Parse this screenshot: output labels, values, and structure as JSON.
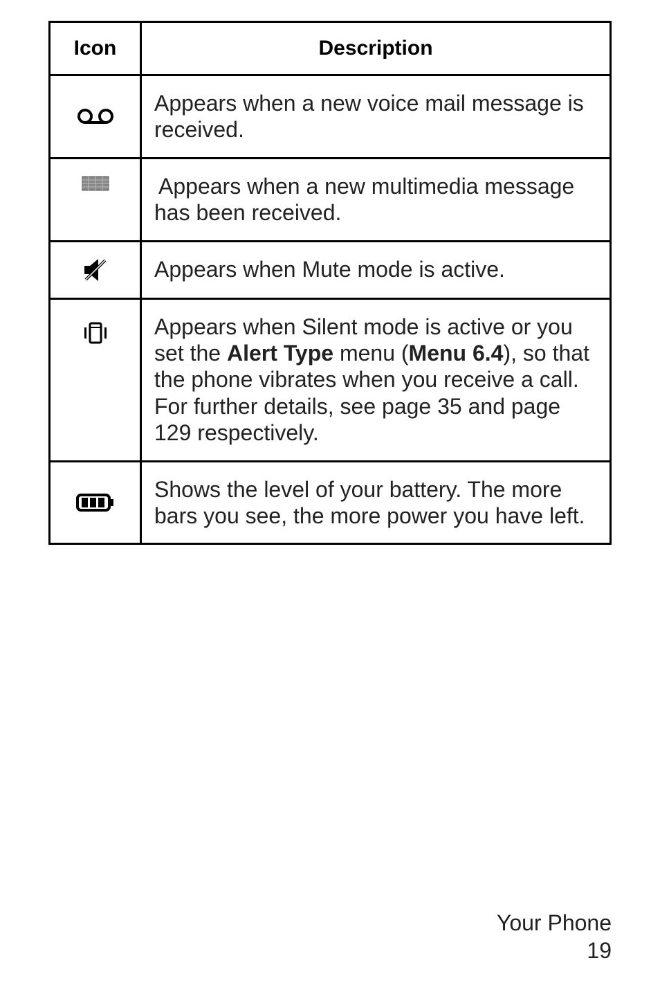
{
  "table": {
    "header": {
      "icon": "Icon",
      "description": "Description"
    },
    "rows": [
      {
        "icon": "voicemail-icon",
        "desc_plain": "Appears when a new voice mail message is received."
      },
      {
        "icon": "mms-icon",
        "desc_plain": "Appears when a new multimedia message has been received."
      },
      {
        "icon": "mute-icon",
        "desc_plain": "Appears when Mute mode is active."
      },
      {
        "icon": "vibrate-icon",
        "desc_parts": {
          "p1": "Appears when Silent mode is active or you set the ",
          "b1": "Alert Type",
          "p2": " menu (",
          "b2": "Menu 6.4",
          "p3": "), so that the phone vibrates when you receive a call. For further details, see page 35 and page 129 respectively."
        }
      },
      {
        "icon": "battery-icon",
        "desc_plain": "Shows the level of your battery. The more bars you see, the more power you have left."
      }
    ]
  },
  "footer": {
    "section": "Your Phone",
    "page": "19"
  }
}
